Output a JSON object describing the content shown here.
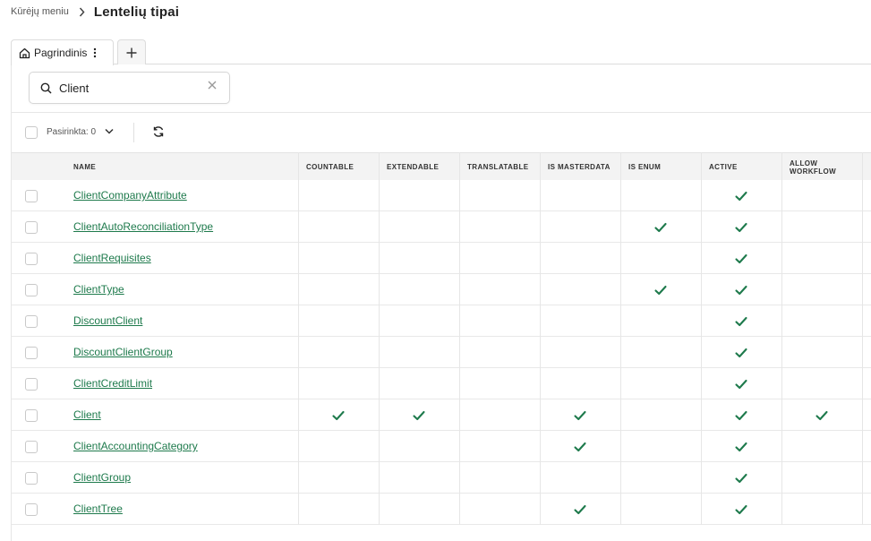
{
  "breadcrumb": {
    "parent": "Kūrėjų meniu",
    "current": "Lentelių tipai"
  },
  "tabs": {
    "main_label": "Pagrindinis",
    "add_label": "+"
  },
  "search": {
    "value": "Client"
  },
  "toolbar": {
    "selected_label": "Pasirinkta: 0"
  },
  "colors": {
    "accent": "#1e7a4c",
    "check": "#1e7a4c"
  },
  "table": {
    "columns": [
      "NAME",
      "COUNTABLE",
      "EXTENDABLE",
      "TRANSLATABLE",
      "IS MASTERDATA",
      "IS ENUM",
      "ACTIVE",
      "ALLOW WORKFLOW"
    ],
    "rows": [
      {
        "name": "ClientCompanyAttribute",
        "checks": [
          false,
          false,
          false,
          false,
          false,
          true,
          false
        ]
      },
      {
        "name": "ClientAutoReconciliationType",
        "checks": [
          false,
          false,
          false,
          false,
          true,
          true,
          false
        ]
      },
      {
        "name": "ClientRequisites",
        "checks": [
          false,
          false,
          false,
          false,
          false,
          true,
          false
        ]
      },
      {
        "name": "ClientType",
        "checks": [
          false,
          false,
          false,
          false,
          true,
          true,
          false
        ]
      },
      {
        "name": "DiscountClient",
        "checks": [
          false,
          false,
          false,
          false,
          false,
          true,
          false
        ]
      },
      {
        "name": "DiscountClientGroup",
        "checks": [
          false,
          false,
          false,
          false,
          false,
          true,
          false
        ]
      },
      {
        "name": "ClientCreditLimit",
        "checks": [
          false,
          false,
          false,
          false,
          false,
          true,
          false
        ]
      },
      {
        "name": "Client",
        "checks": [
          true,
          true,
          false,
          true,
          false,
          true,
          true
        ]
      },
      {
        "name": "ClientAccountingCategory",
        "checks": [
          false,
          false,
          false,
          true,
          false,
          true,
          false
        ]
      },
      {
        "name": "ClientGroup",
        "checks": [
          false,
          false,
          false,
          false,
          false,
          true,
          false
        ]
      },
      {
        "name": "ClientTree",
        "checks": [
          false,
          false,
          false,
          true,
          false,
          true,
          false
        ]
      }
    ]
  }
}
